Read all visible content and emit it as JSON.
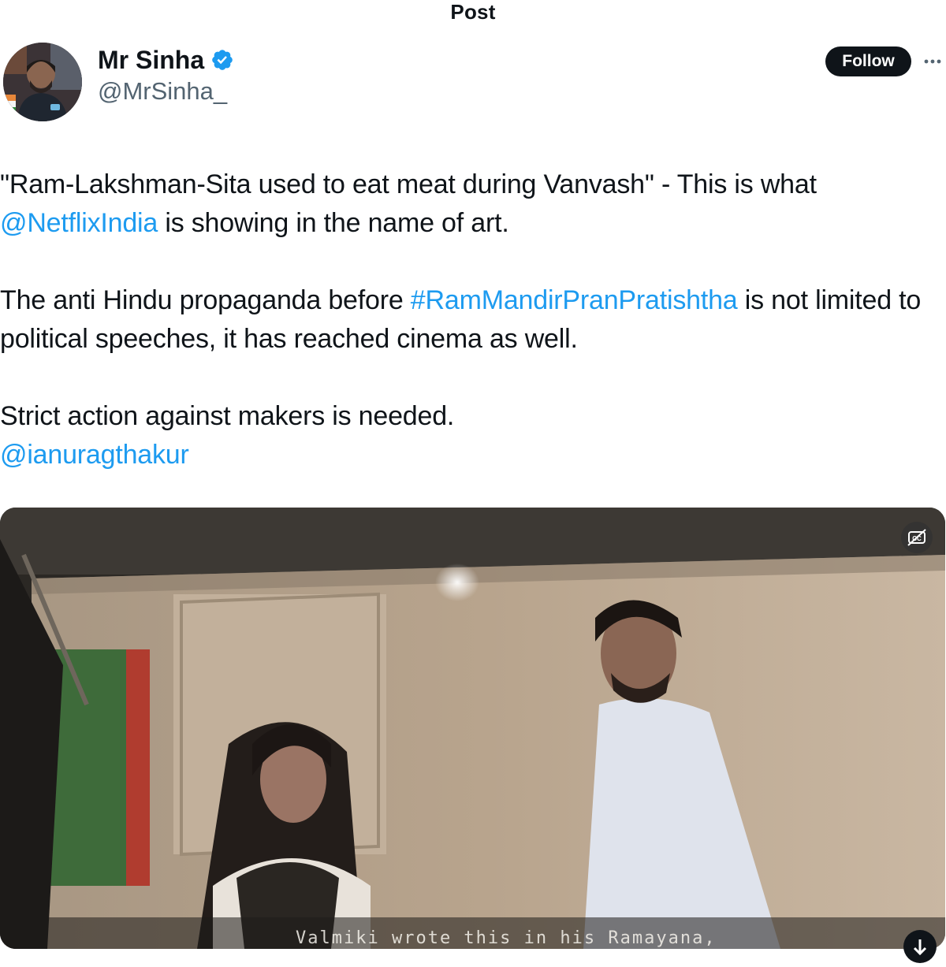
{
  "header": {
    "title": "Post"
  },
  "author": {
    "display_name": "Mr Sinha",
    "handle": "@MrSinha_",
    "verified": true,
    "follow_label": "Follow"
  },
  "tweet": {
    "paragraph1": {
      "pre": "\"Ram-Lakshman-Sita used to eat meat during Vanvash\" - This is what ",
      "mention": "@NetflixIndia",
      "post": " is showing in the name of art."
    },
    "paragraph2": {
      "pre": "The anti Hindu propaganda before ",
      "hashtag": "#RamMandirPranPratishtha",
      "post": " is not limited to political speeches, it has reached cinema as well."
    },
    "paragraph3": {
      "line": "Strict action against makers is needed.",
      "mention": "@ianuragthakur"
    }
  },
  "media": {
    "subtitle_text": "Valmiki wrote this in his Ramayana,",
    "cc_icon": "captions-off-icon"
  },
  "colors": {
    "link": "#1d9bf0",
    "text": "#0f1419",
    "secondary": "#536471",
    "verified": "#1d9bf0"
  }
}
